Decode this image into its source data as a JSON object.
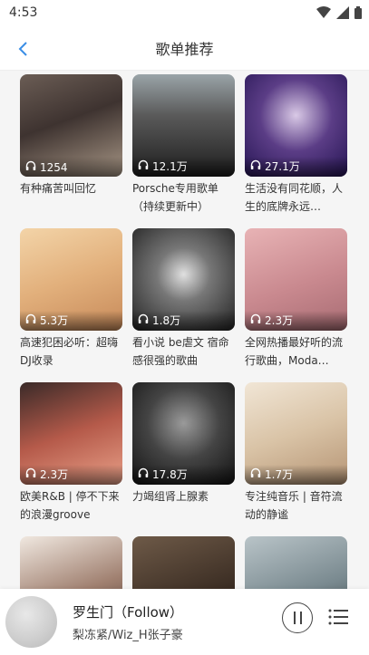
{
  "status": {
    "time": "4:53"
  },
  "header": {
    "title": "歌单推荐"
  },
  "playlists": [
    {
      "count": "1254",
      "title": "有种痛苦叫回忆",
      "bg": "linear-gradient(160deg,#6b5d55 0%,#3e3330 45%,#a89786 100%)"
    },
    {
      "count": "12.1万",
      "title": "Porsche专用歌单（持续更新中）",
      "bg": "linear-gradient(180deg,#9aa4a8 0%,#5a5a5a 40%,#1d1d1d 100%)"
    },
    {
      "count": "27.1万",
      "title": "生活没有同花顺，人生的底牌永远…",
      "bg": "radial-gradient(circle at 50% 40%,#d9c9e6 0%,#5b3d86 45%,#241452 100%)"
    },
    {
      "count": "5.3万",
      "title": "高速犯困必听：超嗨DJ收录",
      "bg": "linear-gradient(160deg,#f3d4a8 0%,#e2b07c 50%,#c78a5a 100%)"
    },
    {
      "count": "1.8万",
      "title": "看小说 be虐文 宿命感很强的歌曲",
      "bg": "radial-gradient(circle at 50% 45%,#e0e0e0 0%,#777 35%,#222 100%)"
    },
    {
      "count": "2.3万",
      "title": "全网热播最好听的流行歌曲，Moda…",
      "bg": "linear-gradient(160deg,#e8b3b5 0%,#c9898f 55%,#a86c73 100%)"
    },
    {
      "count": "2.3万",
      "title": "欧美R&B | 停不下来的浪漫groove",
      "bg": "linear-gradient(160deg,#3a2a28 0%,#b55a4a 50%,#e8a088 100%)"
    },
    {
      "count": "17.8万",
      "title": "力竭组肾上腺素",
      "bg": "radial-gradient(circle at 50% 40%,#9a9a9a 0%,#444 45%,#121212 100%)"
    },
    {
      "count": "1.7万",
      "title": "专注纯音乐 | 音符流动的静谧",
      "bg": "linear-gradient(160deg,#f1e6d6 0%,#d9c3a6 50%,#b59474 100%)"
    },
    {
      "count": "",
      "title": "",
      "bg": "linear-gradient(160deg,#f0e8e0 0%,#a08070 55%,#4a3a34 100%)"
    },
    {
      "count": "",
      "title": "",
      "bg": "linear-gradient(160deg,#6e5a48 0%,#3c2e24 60%,#1e1814 100%)"
    },
    {
      "count": "",
      "title": "",
      "bg": "linear-gradient(160deg,#b9c4c8 0%,#7a8a90 55%,#3a4448 100%)"
    }
  ],
  "player": {
    "song": "罗生门（Follow）",
    "artist": "梨冻紧/Wiz_H张子豪"
  }
}
